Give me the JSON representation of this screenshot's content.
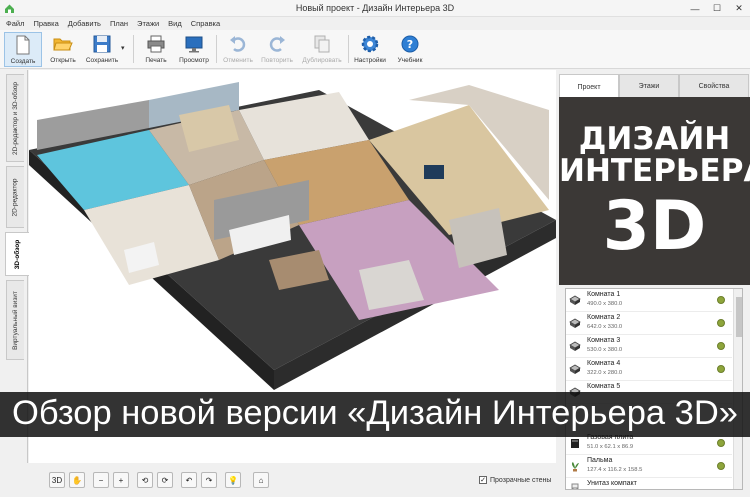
{
  "window": {
    "title": "Новый проект - Дизайн Интерьера 3D",
    "controls": {
      "minimize": "—",
      "maximize": "☐",
      "close": "✕"
    }
  },
  "menu": [
    "Файл",
    "Правка",
    "Добавить",
    "План",
    "Этажи",
    "Вид",
    "Справка"
  ],
  "toolbar": {
    "buttons": [
      {
        "label": "Создать",
        "icon": "new-file-icon",
        "state": "active"
      },
      {
        "label": "Открыть",
        "icon": "folder-open-icon",
        "state": "normal"
      },
      {
        "label": "Сохранить",
        "icon": "floppy-disk-icon",
        "state": "normal"
      },
      {
        "label": "Печать",
        "icon": "printer-icon",
        "state": "normal"
      },
      {
        "label": "Просмотр",
        "icon": "monitor-icon",
        "state": "normal"
      },
      {
        "label": "Отменить",
        "icon": "undo-icon",
        "state": "disabled"
      },
      {
        "label": "Повторить",
        "icon": "redo-icon",
        "state": "disabled"
      },
      {
        "label": "Дублировать",
        "icon": "duplicate-icon",
        "state": "disabled"
      },
      {
        "label": "Настройки",
        "icon": "gear-icon",
        "state": "normal"
      },
      {
        "label": "Учебник",
        "icon": "help-icon",
        "state": "normal"
      }
    ]
  },
  "view_tabs": [
    {
      "label": "2D-редактор и 3D-обзор",
      "active": false
    },
    {
      "label": "2D-редактор",
      "active": false
    },
    {
      "label": "3D-обзор",
      "active": true
    },
    {
      "label": "Виртуальный визит",
      "active": false
    }
  ],
  "bottom_tools": [
    "3D",
    "✋",
    "−",
    "+",
    "⟲",
    "⟳",
    "↶",
    "↷",
    "💡",
    "⌂"
  ],
  "transparent_walls": {
    "label": "Прозрачные стены",
    "checked": true,
    "mark": "✓"
  },
  "right_tabs": [
    {
      "label": "Проект",
      "active": true
    },
    {
      "label": "Этажи",
      "active": false
    },
    {
      "label": "Свойства",
      "active": false
    }
  ],
  "promo": {
    "line1": "ДИЗАЙН",
    "line2": "ИНТЕРЬЕРА",
    "line3": "3D"
  },
  "objects": [
    {
      "name": "Комната 1",
      "size": "490.0 x 380.0",
      "icon": "room-icon"
    },
    {
      "name": "Комната 2",
      "size": "642.0 x 330.0",
      "icon": "room-icon"
    },
    {
      "name": "Комната 3",
      "size": "530.0 x 380.0",
      "icon": "room-icon"
    },
    {
      "name": "Комната 4",
      "size": "322.0 x 280.0",
      "icon": "room-icon"
    },
    {
      "name": "Комната 5",
      "size": "",
      "icon": "room-icon"
    },
    {
      "name": "Газовая плита",
      "size": "51.0 x 62.1 x 86.9",
      "icon": "stove-icon"
    },
    {
      "name": "Пальма",
      "size": "127.4 x 116.2 x 158.5",
      "icon": "plant-icon"
    },
    {
      "name": "Унитаз компакт",
      "size": "",
      "icon": "toilet-icon"
    }
  ],
  "banner": {
    "text": "Обзор новой версии «Дизайн Интерьера 3D»"
  },
  "colors": {
    "accent": "#2b7cd3",
    "promo_bg": "#3b3836",
    "eye": "#8ea53b"
  }
}
